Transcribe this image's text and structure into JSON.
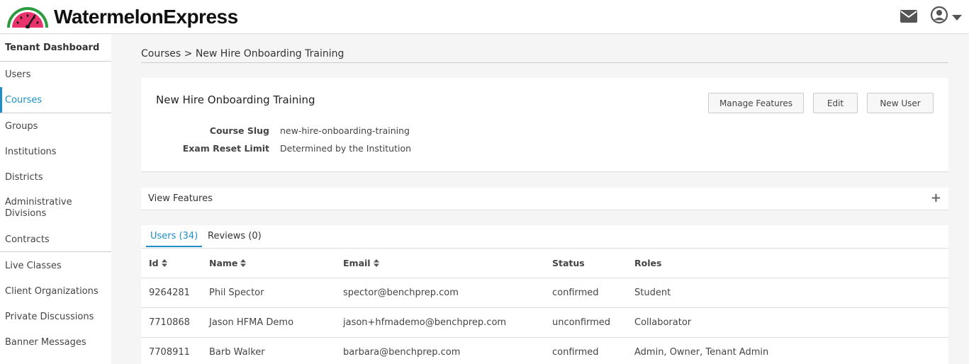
{
  "header": {
    "app_name": "WatermelonExpress",
    "logo_icon": "watermelon-speedometer-icon",
    "mail_icon": "envelope-icon",
    "user_icon": "user-circle-icon",
    "caret_icon": "caret-down-icon"
  },
  "sidebar": {
    "header": "Tenant Dashboard",
    "items": [
      "Users",
      "Courses",
      "Groups",
      "Institutions",
      "Districts",
      "Administrative Divisions",
      "Contracts",
      "Live Classes",
      "Client Organizations",
      "Private Discussions",
      "Banner Messages"
    ],
    "active": "Courses"
  },
  "breadcrumb": {
    "parent": "Courses",
    "separator": ">",
    "current": "New Hire Onboarding Training"
  },
  "course": {
    "title": "New Hire Onboarding Training",
    "buttons": {
      "manage_features": "Manage Features",
      "edit": "Edit",
      "new_user": "New User"
    },
    "fields": [
      {
        "label": "Course Slug",
        "value": "new-hire-onboarding-training"
      },
      {
        "label": "Exam Reset Limit",
        "value": "Determined by the Institution"
      }
    ]
  },
  "features": {
    "label": "View Features",
    "toggle": "+"
  },
  "tabs": [
    {
      "label": "Users (34)",
      "active": true
    },
    {
      "label": "Reviews (0)",
      "active": false
    }
  ],
  "table": {
    "columns": [
      "Id",
      "Name",
      "Email",
      "Status",
      "Roles"
    ],
    "rows": [
      [
        "9264281",
        "Phil Spector",
        "spector@benchprep.com",
        "confirmed",
        "Student"
      ],
      [
        "7710868",
        "Jason HFMA Demo",
        "jason+hfmademo@benchprep.com",
        "unconfirmed",
        "Collaborator"
      ],
      [
        "7708911",
        "Barb Walker",
        "barbara@benchprep.com",
        "confirmed",
        "Admin, Owner, Tenant Admin"
      ]
    ]
  },
  "colors": {
    "accent": "#1e8fc6",
    "logo_pink": "#e8336d",
    "logo_green": "#2e9a3e"
  }
}
